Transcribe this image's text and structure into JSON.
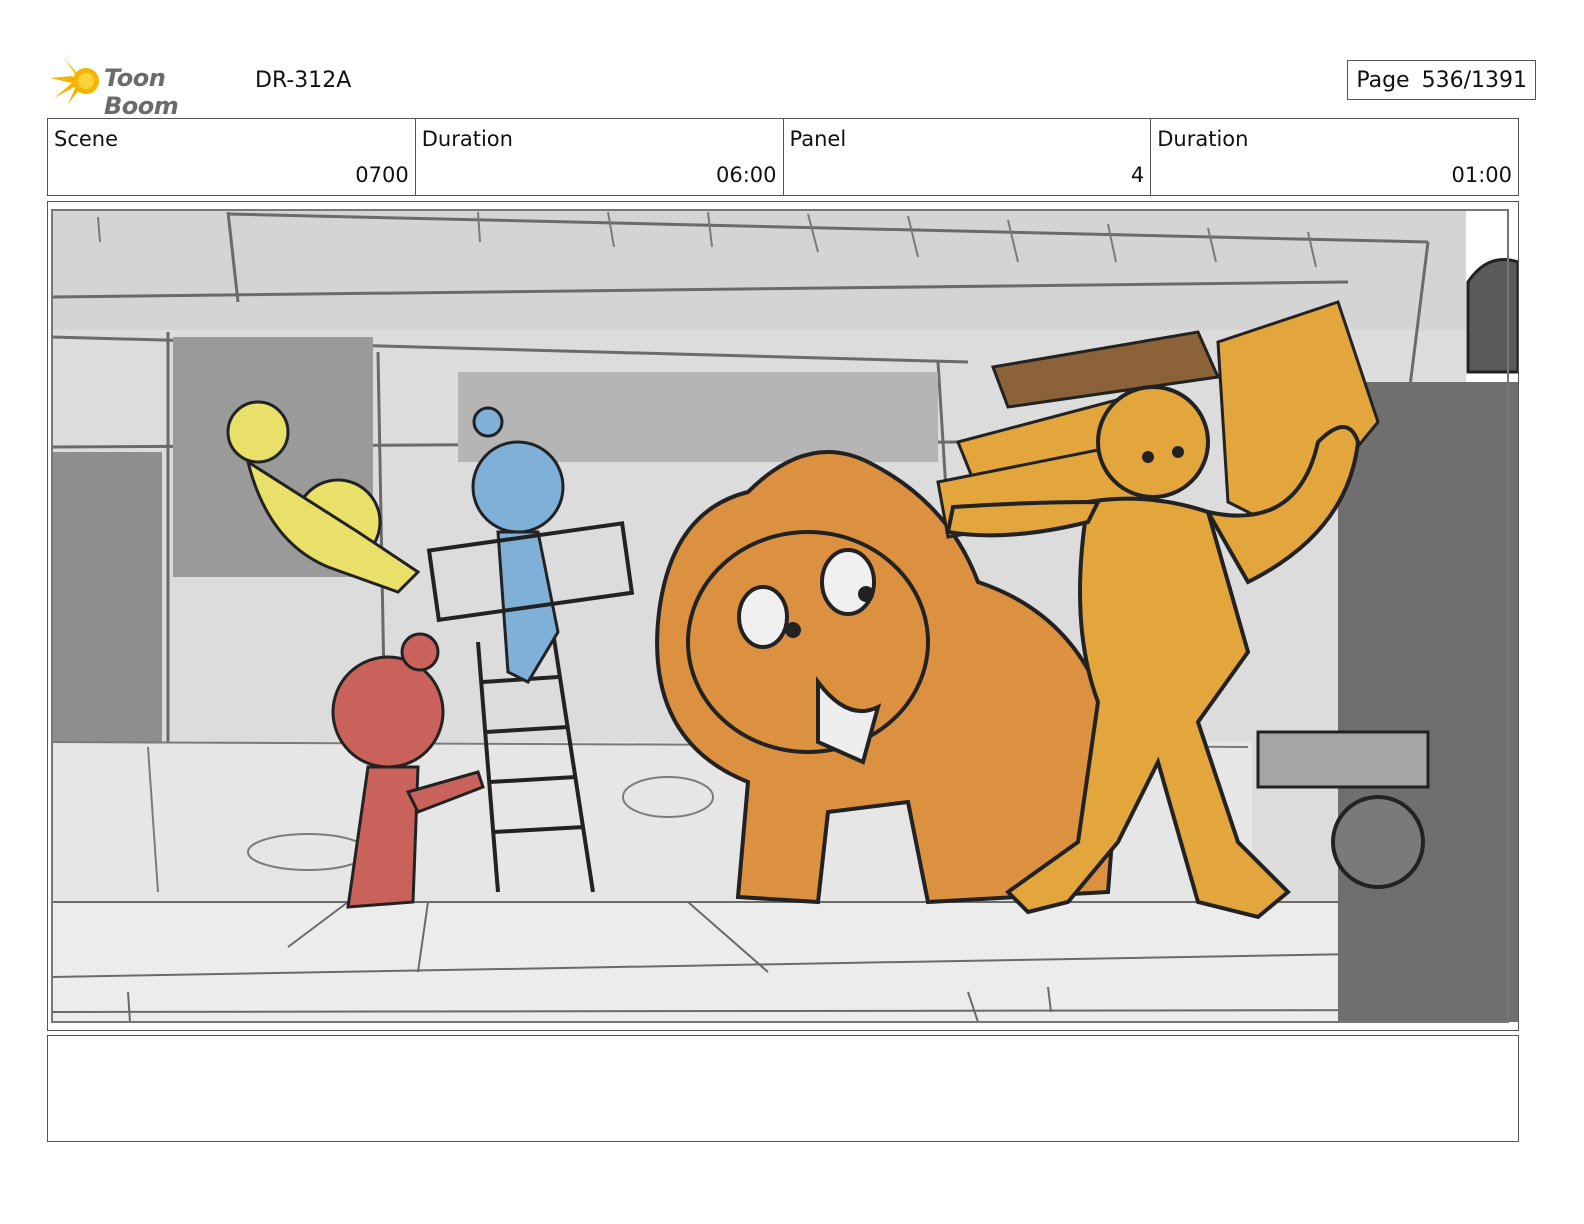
{
  "header": {
    "logo_text": "Toon Boom",
    "doc_id": "DR-312A",
    "page_label": "Page",
    "page_value": "536/1391"
  },
  "info": {
    "scene_label": "Scene",
    "scene_value": "0700",
    "scene_duration_label": "Duration",
    "scene_duration_value": "06:00",
    "panel_label": "Panel",
    "panel_value": "4",
    "panel_duration_label": "Duration",
    "panel_duration_value": "01:00"
  },
  "colors": {
    "logo_star": "#f5b400",
    "char_yellow": "#e9e06a",
    "char_blue": "#7fb0d8",
    "char_red": "#c8625a",
    "creature_orange": "#dc9140",
    "carrier_gold": "#e2a63c",
    "boxes_brown": "#8c6238"
  }
}
